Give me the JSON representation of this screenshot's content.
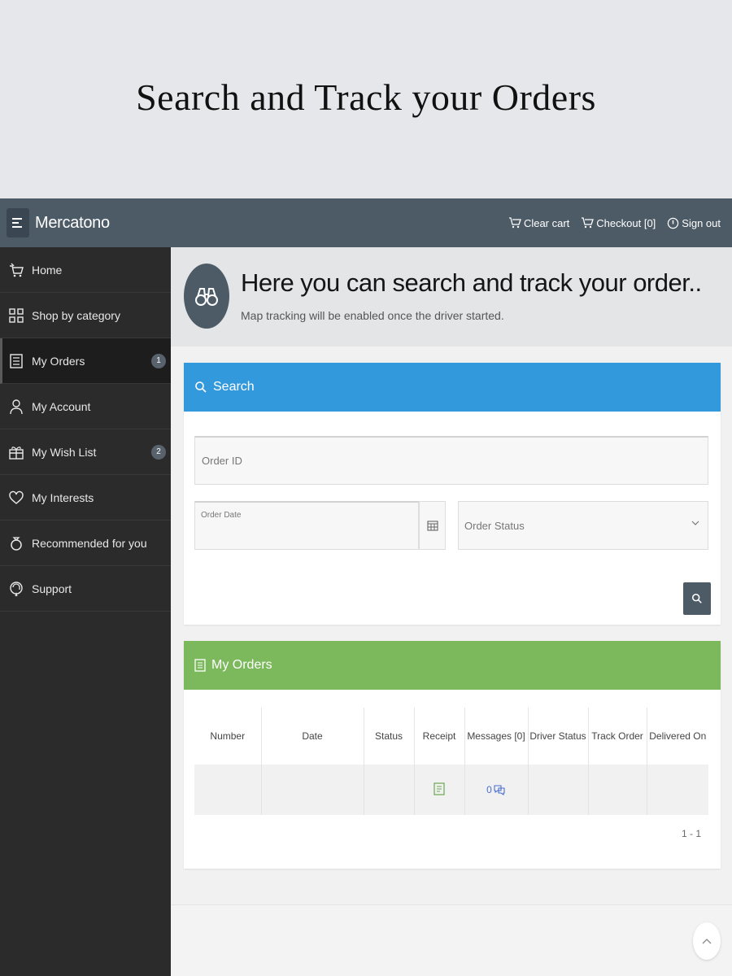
{
  "banner": {
    "title": "Search and Track your Orders"
  },
  "topbar": {
    "brand": "Mercatono",
    "actions": [
      {
        "label": "Clear cart",
        "icon": "cart-icon"
      },
      {
        "label": "Checkout [0]",
        "icon": "cart-icon"
      },
      {
        "label": "Sign out",
        "icon": "power-icon"
      }
    ]
  },
  "sidebar": {
    "items": [
      {
        "label": "Home",
        "icon": "basket-icon"
      },
      {
        "label": "Shop by category",
        "icon": "grid-icon"
      },
      {
        "label": "My Orders",
        "icon": "document-icon",
        "badge": "1",
        "active": true
      },
      {
        "label": "My Account",
        "icon": "user-icon"
      },
      {
        "label": "My Wish List",
        "icon": "gift-icon",
        "badge": "2"
      },
      {
        "label": "My Interests",
        "icon": "heart-icon"
      },
      {
        "label": "Recommended for you",
        "icon": "ring-icon"
      },
      {
        "label": "Support",
        "icon": "support-icon"
      }
    ]
  },
  "hero": {
    "title": "Here you can search and track your order..",
    "subtitle": "Map tracking will be enabled once the driver started."
  },
  "search_panel": {
    "title": "Search",
    "order_id_placeholder": "Order ID",
    "order_date_label": "Order Date",
    "order_status_placeholder": "Order Status"
  },
  "orders_panel": {
    "title": "My Orders",
    "columns": [
      "Number",
      "Date",
      "Status",
      "Receipt",
      "Messages [0]",
      "Driver Status",
      "Track Order",
      "Delivered On"
    ],
    "row": {
      "messages_count": "0"
    },
    "pagination": "1 - 1"
  },
  "colors": {
    "topbar": "#4d5b67",
    "sidebar": "#2b2b2b",
    "search_header": "#3399dd",
    "orders_header": "#7cb85c"
  }
}
